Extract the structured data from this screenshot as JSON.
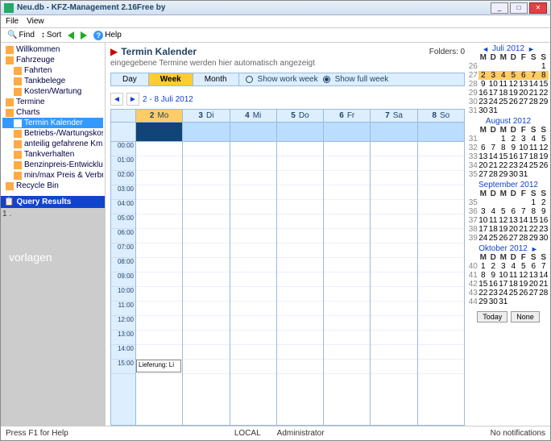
{
  "window": {
    "title": "Neu.db - KFZ-Management 2.16Free by"
  },
  "menu": {
    "file": "File",
    "view": "View"
  },
  "toolbar": {
    "find": "Find",
    "sort": "Sort",
    "help": "Help"
  },
  "tree": {
    "items": [
      {
        "label": "Willkommen",
        "indent": 0
      },
      {
        "label": "Fahrzeuge",
        "indent": 0
      },
      {
        "label": "Fahrten",
        "indent": 1
      },
      {
        "label": "Tankbelege",
        "indent": 1
      },
      {
        "label": "Kosten/Wartung",
        "indent": 1
      },
      {
        "label": "Termine",
        "indent": 0
      },
      {
        "label": "Charts",
        "indent": 0
      },
      {
        "label": "Termin Kalender",
        "indent": 1,
        "selected": true
      },
      {
        "label": "Betriebs-/Wartungskosten",
        "indent": 1
      },
      {
        "label": "anteilig gefahrene Km",
        "indent": 1
      },
      {
        "label": "Tankverhalten",
        "indent": 1
      },
      {
        "label": "Benzinpreis-Entwicklung",
        "indent": 1
      },
      {
        "label": "min/max Preis & Verbrauch",
        "indent": 1
      },
      {
        "label": "Recycle Bin",
        "indent": 0
      }
    ]
  },
  "query": {
    "header": "Query Results",
    "first": "1 ."
  },
  "watermark": "vorlagen",
  "cal": {
    "title": "Termin Kalender",
    "subtitle": "eingegebene Termine werden hier automatisch angezeigt",
    "folders_label": "Folders:",
    "folders_count": "0",
    "view_day": "Day",
    "view_week": "Week",
    "view_month": "Month",
    "show_work": "Show work week",
    "show_full": "Show full week",
    "date_range": "2 - 8 Juli 2012",
    "days": [
      {
        "num": "2",
        "name": "Mo",
        "today": true
      },
      {
        "num": "3",
        "name": "Di"
      },
      {
        "num": "4",
        "name": "Mi"
      },
      {
        "num": "5",
        "name": "Do"
      },
      {
        "num": "6",
        "name": "Fr"
      },
      {
        "num": "7",
        "name": "Sa"
      },
      {
        "num": "8",
        "name": "So"
      }
    ],
    "hours": [
      "00:00",
      "01:00",
      "02:00",
      "03:00",
      "04:00",
      "05:00",
      "06:00",
      "07:00",
      "08:00",
      "09:00",
      "10:00",
      "11:00",
      "12:00",
      "13:00",
      "14:00",
      "15:00"
    ],
    "event": {
      "text": "Lieferung: Li"
    }
  },
  "mini": {
    "day_headers": [
      "M",
      "D",
      "M",
      "D",
      "F",
      "S",
      "S"
    ],
    "months": [
      {
        "title": "Juli 2012",
        "first_nav": true,
        "weeks": [
          {
            "wk": "26",
            "d": [
              "",
              "",
              "",
              "",
              "",
              "",
              "1"
            ]
          },
          {
            "wk": "27",
            "d": [
              "2",
              "3",
              "4",
              "5",
              "6",
              "7",
              "8"
            ],
            "hl": true
          },
          {
            "wk": "28",
            "d": [
              "9",
              "10",
              "11",
              "12",
              "13",
              "14",
              "15"
            ]
          },
          {
            "wk": "29",
            "d": [
              "16",
              "17",
              "18",
              "19",
              "20",
              "21",
              "22"
            ]
          },
          {
            "wk": "30",
            "d": [
              "23",
              "24",
              "25",
              "26",
              "27",
              "28",
              "29"
            ]
          },
          {
            "wk": "31",
            "d": [
              "30",
              "31",
              "",
              "",
              "",
              "",
              ""
            ]
          }
        ]
      },
      {
        "title": "August 2012",
        "weeks": [
          {
            "wk": "31",
            "d": [
              "",
              "",
              "1",
              "2",
              "3",
              "4",
              "5"
            ]
          },
          {
            "wk": "32",
            "d": [
              "6",
              "7",
              "8",
              "9",
              "10",
              "11",
              "12"
            ]
          },
          {
            "wk": "33",
            "d": [
              "13",
              "14",
              "15",
              "16",
              "17",
              "18",
              "19"
            ]
          },
          {
            "wk": "34",
            "d": [
              "20",
              "21",
              "22",
              "23",
              "24",
              "25",
              "26"
            ]
          },
          {
            "wk": "35",
            "d": [
              "27",
              "28",
              "29",
              "30",
              "31",
              "",
              ""
            ]
          }
        ]
      },
      {
        "title": "September 2012",
        "weeks": [
          {
            "wk": "35",
            "d": [
              "",
              "",
              "",
              "",
              "",
              "1",
              "2"
            ]
          },
          {
            "wk": "36",
            "d": [
              "3",
              "4",
              "5",
              "6",
              "7",
              "8",
              "9"
            ]
          },
          {
            "wk": "37",
            "d": [
              "10",
              "11",
              "12",
              "13",
              "14",
              "15",
              "16"
            ]
          },
          {
            "wk": "38",
            "d": [
              "17",
              "18",
              "19",
              "20",
              "21",
              "22",
              "23"
            ]
          },
          {
            "wk": "39",
            "d": [
              "24",
              "25",
              "26",
              "27",
              "28",
              "29",
              "30"
            ]
          }
        ]
      },
      {
        "title": "Oktober 2012",
        "last_nav": true,
        "weeks": [
          {
            "wk": "40",
            "d": [
              "1",
              "2",
              "3",
              "4",
              "5",
              "6",
              "7"
            ]
          },
          {
            "wk": "41",
            "d": [
              "8",
              "9",
              "10",
              "11",
              "12",
              "13",
              "14"
            ]
          },
          {
            "wk": "42",
            "d": [
              "15",
              "16",
              "17",
              "18",
              "19",
              "20",
              "21"
            ]
          },
          {
            "wk": "43",
            "d": [
              "22",
              "23",
              "24",
              "25",
              "26",
              "27",
              "28"
            ]
          },
          {
            "wk": "44",
            "d": [
              "29",
              "30",
              "31",
              "",
              "",
              "",
              ""
            ]
          }
        ]
      }
    ],
    "today_btn": "Today",
    "none_btn": "None"
  },
  "status": {
    "help": "Press F1 for Help",
    "mode": "LOCAL",
    "user": "Administrator",
    "notif": "No notifications"
  }
}
